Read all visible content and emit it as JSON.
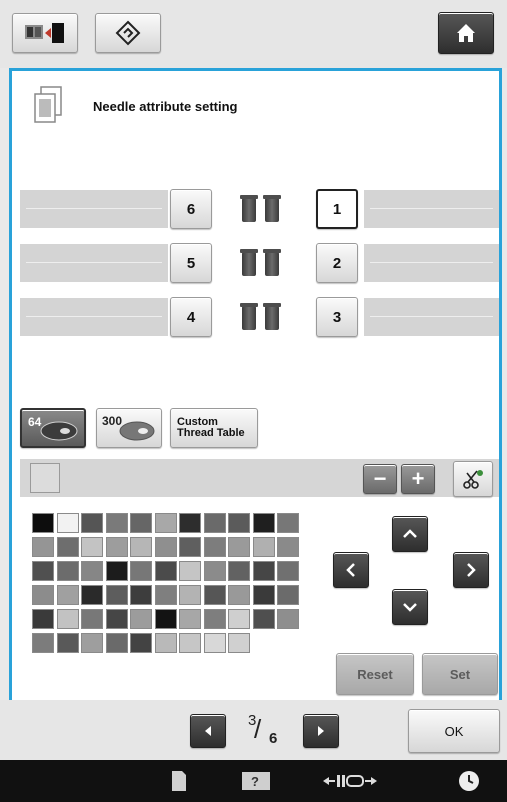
{
  "panel": {
    "title": "Needle attribute setting"
  },
  "needles": {
    "left": [
      "6",
      "5",
      "4"
    ],
    "right": [
      "1",
      "2",
      "3"
    ]
  },
  "thread_tables": {
    "tab1_label": "64",
    "tab2_label": "300",
    "custom_label_line1": "Custom",
    "custom_label_line2": "Thread Table"
  },
  "controls": {
    "minus": "−",
    "plus": "+",
    "reset": "Reset",
    "set": "Set"
  },
  "palette_rows": [
    [
      "#0d0d0d",
      "#f2f2f2",
      "#555555",
      "#7a7a7a",
      "#666666",
      "#a8a8a8",
      "#2d2d2d",
      "#6a6a6a",
      "#5b5b5b",
      "#1f1f1f",
      "#777777"
    ],
    [
      "#959595",
      "#6e6e6e",
      "#c3c3c3",
      "#9d9d9d",
      "#b6b6b6",
      "#8f8f8f",
      "#5f5f5f",
      "#7d7d7d",
      "#9a9a9a",
      "#b0b0b0",
      "#8a8a8a"
    ],
    [
      "#505050",
      "#6c6c6c",
      "#868686",
      "#1c1c1c",
      "#777777",
      "#4b4b4b",
      "#c5c5c5",
      "#8b8b8b",
      "#626262",
      "#464646",
      "#707070"
    ],
    [
      "#8c8c8c",
      "#a0a0a0",
      "#2a2a2a",
      "#5d5d5d",
      "#3d3d3d",
      "#7f7f7f",
      "#b3b3b3",
      "#565656",
      "#999999",
      "#3a3a3a",
      "#6b6b6b"
    ],
    [
      "#3a3a3a",
      "#c2c2c2",
      "#787878",
      "#464646",
      "#9c9c9c",
      "#131313",
      "#a7a7a7",
      "#7e7e7e",
      "#cfcfcf",
      "#4f4f4f",
      "#8e8e8e"
    ],
    [
      "#7c7c7c",
      "#595959",
      "#9e9e9e",
      "#6a6a6a",
      "#434343",
      "#b9b9b9",
      "#c6c6c6",
      "#d8d8d8",
      "#d0d0d0"
    ]
  ],
  "pager": {
    "current": "3",
    "total": "6",
    "ok": "OK"
  },
  "colors": {
    "accent": "#29a2d9"
  }
}
